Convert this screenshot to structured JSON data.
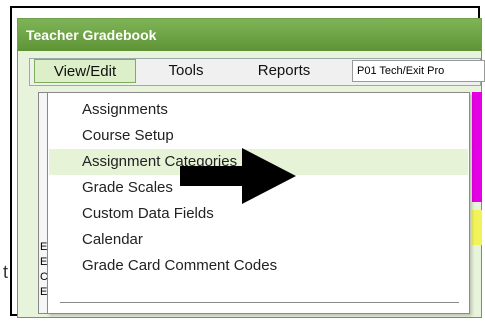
{
  "window": {
    "title": "Teacher Gradebook"
  },
  "menubar": {
    "items": [
      {
        "label": "View/Edit",
        "active": true
      },
      {
        "label": "Tools"
      },
      {
        "label": "Reports"
      }
    ],
    "period_label": "P01  Tech/Exit Pro"
  },
  "dropdown": {
    "items": [
      {
        "label": "Assignments"
      },
      {
        "label": "Course Setup"
      },
      {
        "label": "Assignment Categories",
        "hover": true
      },
      {
        "label": "Grade Scales"
      },
      {
        "label": "Custom Data Fields"
      },
      {
        "label": "Calendar"
      },
      {
        "label": "Grade Card Comment Codes"
      }
    ]
  },
  "background": {
    "left_strip_letters": [
      "E",
      "E",
      "C",
      "E"
    ],
    "outside_text": "t"
  },
  "colors": {
    "title_green": "#6ea04c",
    "highlight": "#e6f3d6",
    "magenta": "#e400e4",
    "yellow": "#f2f25a"
  },
  "annotation": {
    "arrow_icon": "black-right-arrow"
  }
}
